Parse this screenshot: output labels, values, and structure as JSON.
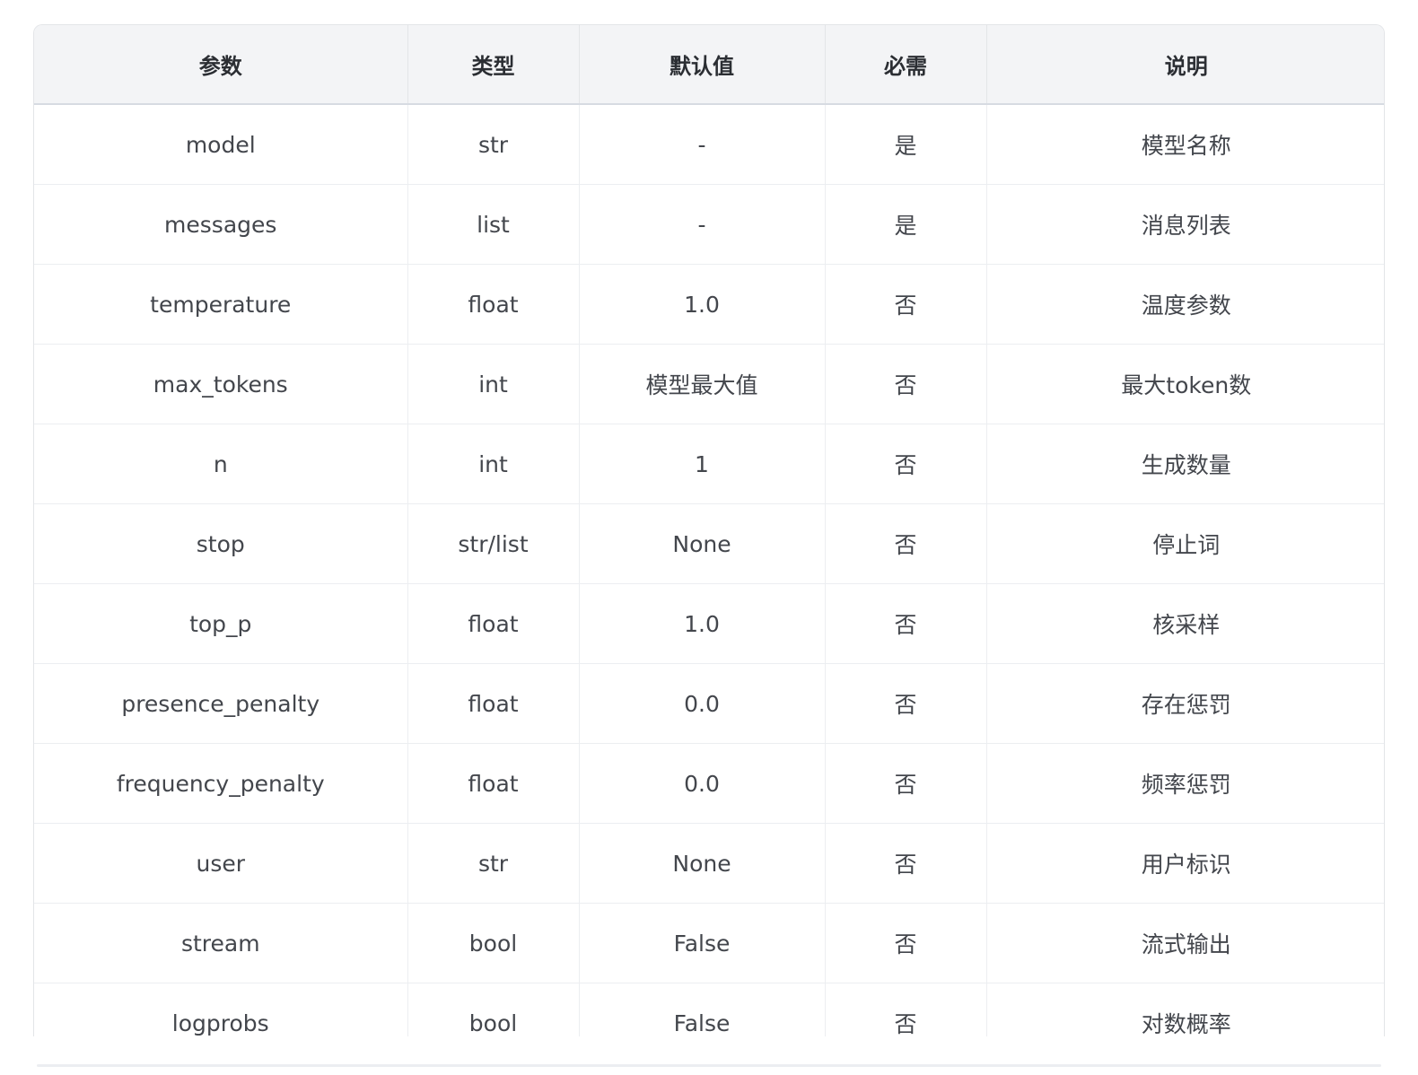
{
  "table": {
    "headers": [
      "参数",
      "类型",
      "默认值",
      "必需",
      "说明"
    ],
    "rows": [
      [
        "model",
        "str",
        "-",
        "是",
        "模型名称"
      ],
      [
        "messages",
        "list",
        "-",
        "是",
        "消息列表"
      ],
      [
        "temperature",
        "float",
        "1.0",
        "否",
        "温度参数"
      ],
      [
        "max_tokens",
        "int",
        "模型最大值",
        "否",
        "最大token数"
      ],
      [
        "n",
        "int",
        "1",
        "否",
        "生成数量"
      ],
      [
        "stop",
        "str/list",
        "None",
        "否",
        "停止词"
      ],
      [
        "top_p",
        "float",
        "1.0",
        "否",
        "核采样"
      ],
      [
        "presence_penalty",
        "float",
        "0.0",
        "否",
        "存在惩罚"
      ],
      [
        "frequency_penalty",
        "float",
        "0.0",
        "否",
        "频率惩罚"
      ],
      [
        "user",
        "str",
        "None",
        "否",
        "用户标识"
      ],
      [
        "stream",
        "bool",
        "False",
        "否",
        "流式输出"
      ],
      [
        "logprobs",
        "bool",
        "False",
        "否",
        "对数概率"
      ]
    ]
  }
}
